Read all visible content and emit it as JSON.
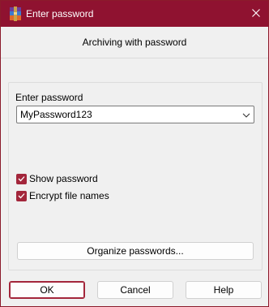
{
  "window": {
    "title": "Enter password",
    "icon": "winrar-archive-icon",
    "close_icon": "close-icon"
  },
  "header": {
    "subtitle": "Archiving with password"
  },
  "password": {
    "label": "Enter password",
    "value": "MyPassword123"
  },
  "options": {
    "show_password": {
      "label": "Show password",
      "checked": true
    },
    "encrypt_file_names": {
      "label": "Encrypt file names",
      "checked": true
    }
  },
  "organize_button": "Organize passwords...",
  "footer": {
    "ok": "OK",
    "cancel": "Cancel",
    "help": "Help"
  },
  "colors": {
    "titlebar": "#8f1230",
    "accent": "#a3263b",
    "background": "#f0f0f0"
  }
}
